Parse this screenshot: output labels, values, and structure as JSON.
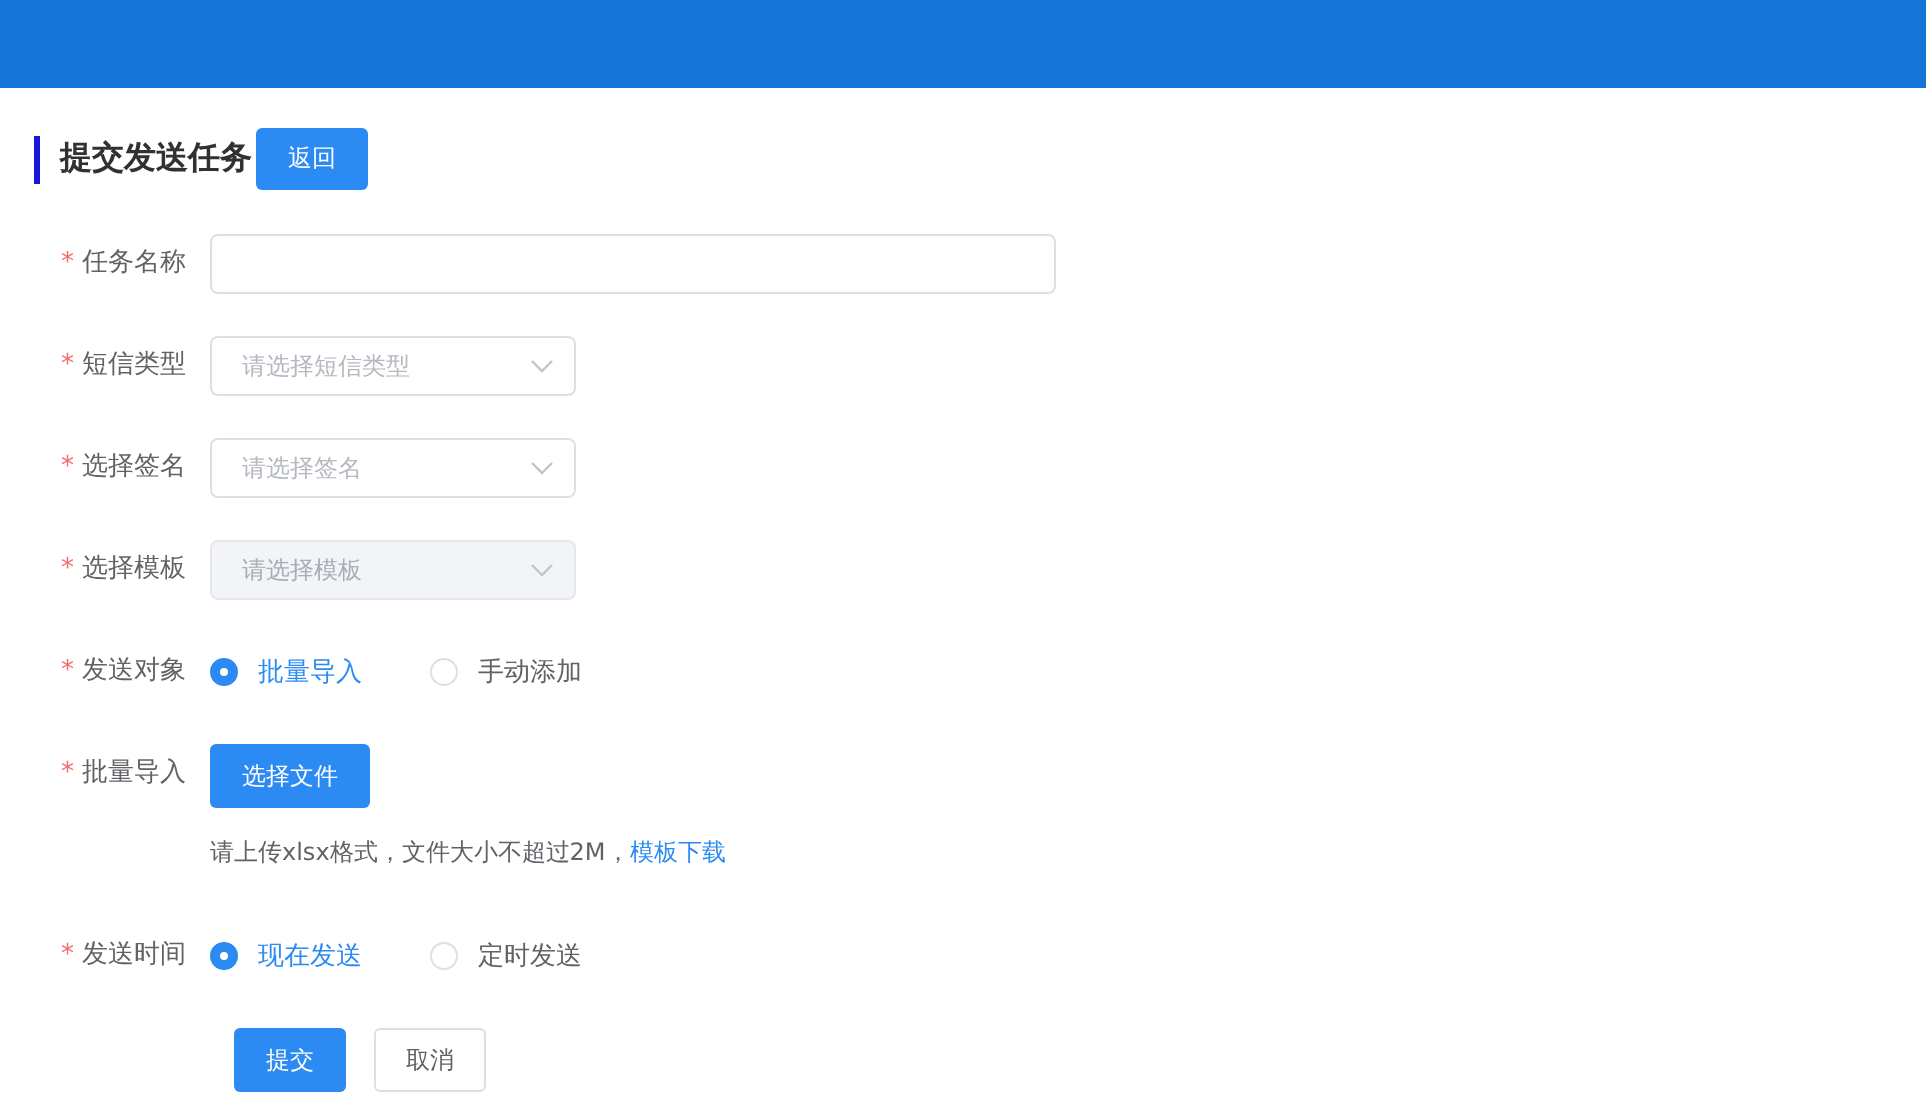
{
  "page": {
    "title": "提交发送任务",
    "back_button": "返回"
  },
  "form": {
    "fields": [
      {
        "kind": "text",
        "required_mark": "*",
        "label": "任务名称"
      },
      {
        "kind": "select",
        "required_mark": "*",
        "label": "短信类型",
        "placeholder": "请选择短信类型",
        "disabled": false
      },
      {
        "kind": "select",
        "required_mark": "*",
        "label": "选择签名",
        "placeholder": "请选择签名",
        "disabled": false
      },
      {
        "kind": "select",
        "required_mark": "*",
        "label": "选择模板",
        "placeholder": "请选择模板",
        "disabled": true
      },
      {
        "kind": "radio",
        "required_mark": "*",
        "label": "发送对象",
        "options": [
          {
            "label": "批量导入",
            "selected": true
          },
          {
            "label": "手动添加",
            "selected": false
          }
        ]
      },
      {
        "kind": "file",
        "required_mark": "*",
        "label": "批量导入",
        "button": "选择文件",
        "hint": "请上传xlsx格式，文件大小不超过2M，",
        "hint_link": "模板下载"
      },
      {
        "kind": "radio",
        "required_mark": "*",
        "label": "发送时间",
        "options": [
          {
            "label": "现在发送",
            "selected": true
          },
          {
            "label": "定时发送",
            "selected": false
          }
        ]
      }
    ],
    "actions": {
      "submit": "提交",
      "cancel": "取消"
    }
  }
}
